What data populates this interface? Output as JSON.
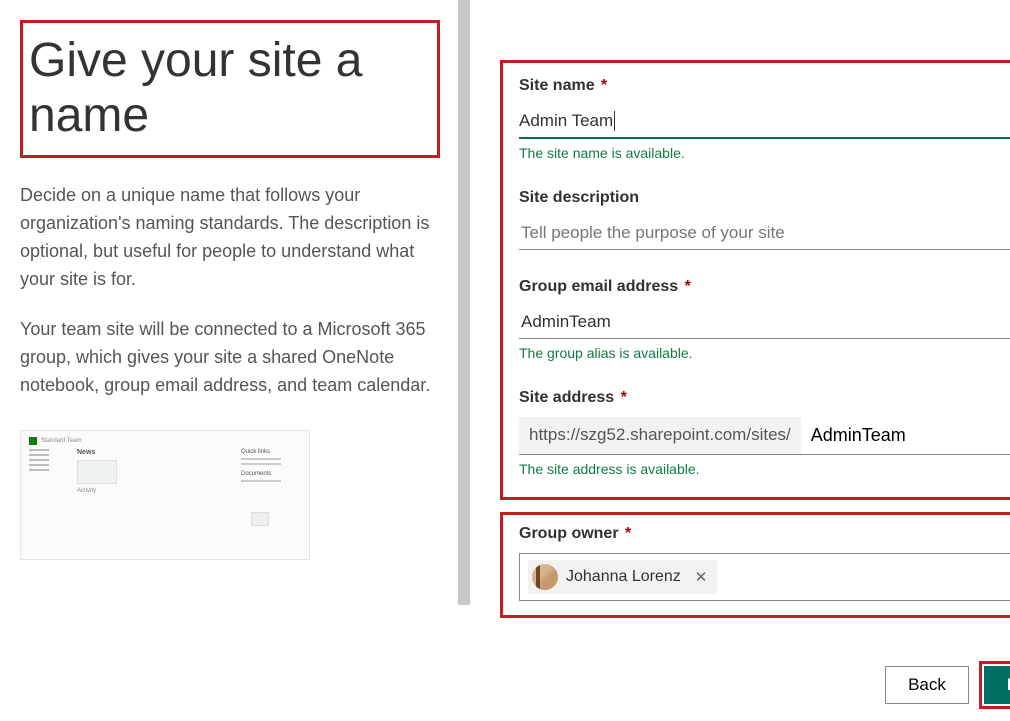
{
  "left": {
    "title": "Give your site a name",
    "para1": "Decide on a unique name that follows your organization's naming standards. The description is optional, but useful for people to understand what your site is for.",
    "para2": "Your team site will be connected to a Microsoft 365 group, which gives your site a shared OneNote notebook, group email address, and team calendar."
  },
  "form": {
    "siteName": {
      "label": "Site name",
      "value": "Admin Team",
      "validation": "The site name is available."
    },
    "siteDesc": {
      "label": "Site description",
      "placeholder": "Tell people the purpose of your site"
    },
    "groupEmail": {
      "label": "Group email address",
      "value": "AdminTeam",
      "validation": "The group alias is available."
    },
    "siteAddr": {
      "label": "Site address",
      "prefix": "https://szg52.sharepoint.com/sites/",
      "value": "AdminTeam",
      "validation": "The site address is available."
    }
  },
  "owner": {
    "label": "Group owner",
    "name": "Johanna Lorenz"
  },
  "buttons": {
    "back": "Back",
    "next": "Next"
  }
}
